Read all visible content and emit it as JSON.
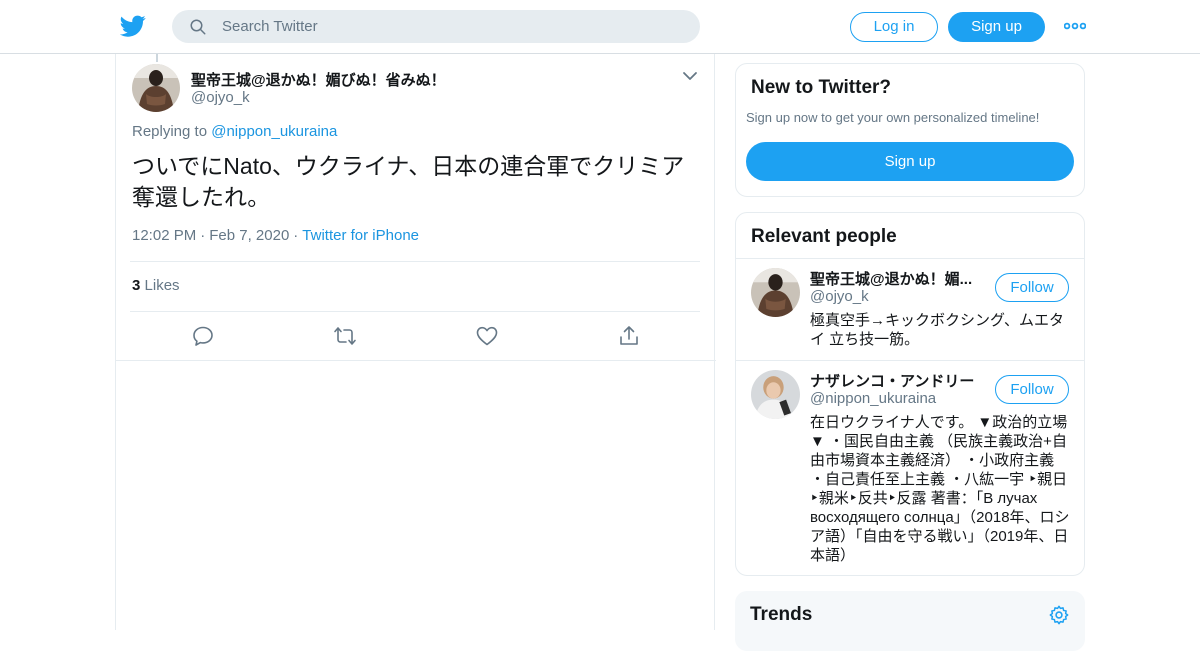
{
  "header": {
    "search_placeholder": "Search Twitter",
    "login_label": "Log in",
    "signup_label": "Sign up",
    "brand_color": "#1da1f2"
  },
  "tweet": {
    "author_name": "聖帝王城@退かぬ！媚びぬ！省みぬ！",
    "author_handle": "@ojyo_k",
    "replying_prefix": "Replying to",
    "replying_to": "@nippon_ukuraina",
    "text": "ついでにNato、ウクライナ、日本の連合軍でクリミア奪還したれ。",
    "time": "12:02 PM",
    "date": "Feb 7, 2020",
    "source": "Twitter for iPhone",
    "likes_count": "3",
    "likes_label": "Likes",
    "actions": [
      {
        "icon": "reply-icon"
      },
      {
        "icon": "retweet-icon"
      },
      {
        "icon": "like-icon"
      },
      {
        "icon": "share-icon"
      }
    ]
  },
  "sidebar": {
    "new_to_twitter": {
      "title": "New to Twitter?",
      "subtitle": "Sign up now to get your own personalized timeline!",
      "button_label": "Sign up"
    },
    "relevant_people": {
      "title": "Relevant people",
      "people": [
        {
          "name": "聖帝王城@退かぬ！媚...",
          "handle": "@ojyo_k",
          "follow_label": "Follow",
          "bio": "極真空手→キックボクシング、ムエタイ 立ち技一筋。"
        },
        {
          "name": "ナザレンコ・アンドリー",
          "handle": "@nippon_ukuraina",
          "follow_label": "Follow",
          "bio": "在日ウクライナ人です。 ▼政治的立場▼ ・国民自由主義 （民族主義政治+自由市場資本主義経済） ・小政府主義 ・自己責任至上主義 ・八紘一宇 ‣親日‣親米‣反共‣反露 著書：「В лучах восходящего солнца」（2018年、ロシア語）「自由を守る戦い」（2019年、日本語）"
        }
      ]
    },
    "trends": {
      "title": "Trends"
    }
  }
}
